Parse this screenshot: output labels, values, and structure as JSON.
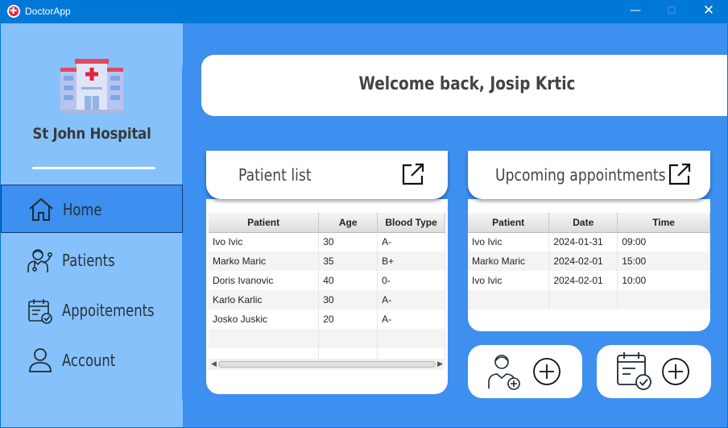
{
  "window": {
    "title": "DoctorApp",
    "minimize_glyph": "—",
    "maximize_glyph": "☐",
    "close_glyph": "✕"
  },
  "sidebar": {
    "hospital_name": "St John Hospital",
    "items": [
      {
        "label": "Home",
        "icon": "home-icon",
        "active": true
      },
      {
        "label": "Patients",
        "icon": "doctor-icon",
        "active": false
      },
      {
        "label": "Appoitements",
        "icon": "calendar-check-icon",
        "active": false
      },
      {
        "label": "Account",
        "icon": "user-icon",
        "active": false
      }
    ]
  },
  "welcome": {
    "text": "Welcome back, Josip Krtic"
  },
  "patient_list": {
    "title": "Patient list",
    "columns": [
      "Patient",
      "Age",
      "Blood Type"
    ],
    "rows": [
      [
        "Ivo Ivic",
        "30",
        "A-"
      ],
      [
        "Marko Maric",
        "35",
        "B+"
      ],
      [
        "Doris Ivanovic",
        "40",
        "0-"
      ],
      [
        "Karlo Karlic",
        "30",
        "A-"
      ],
      [
        "Josko Juskic",
        "20",
        "A-"
      ]
    ]
  },
  "appointments": {
    "title": "Upcoming appointments",
    "columns": [
      "Patient",
      "Date",
      "Time"
    ],
    "rows": [
      [
        "Ivo Ivic",
        "2024-01-31",
        "09:00"
      ],
      [
        "Marko Maric",
        "2024-02-01",
        "15:00"
      ],
      [
        "Ivo Ivic",
        "2024-02-01",
        "10:00"
      ]
    ]
  },
  "actions": [
    {
      "name": "add-patient-button",
      "icon": "add-patient-icon"
    },
    {
      "name": "add-appointment-button",
      "icon": "add-appointment-icon"
    }
  ],
  "colors": {
    "accent": "#3d8ff0",
    "sidebar": "#87c1fb",
    "titlebar": "#0078d7"
  }
}
